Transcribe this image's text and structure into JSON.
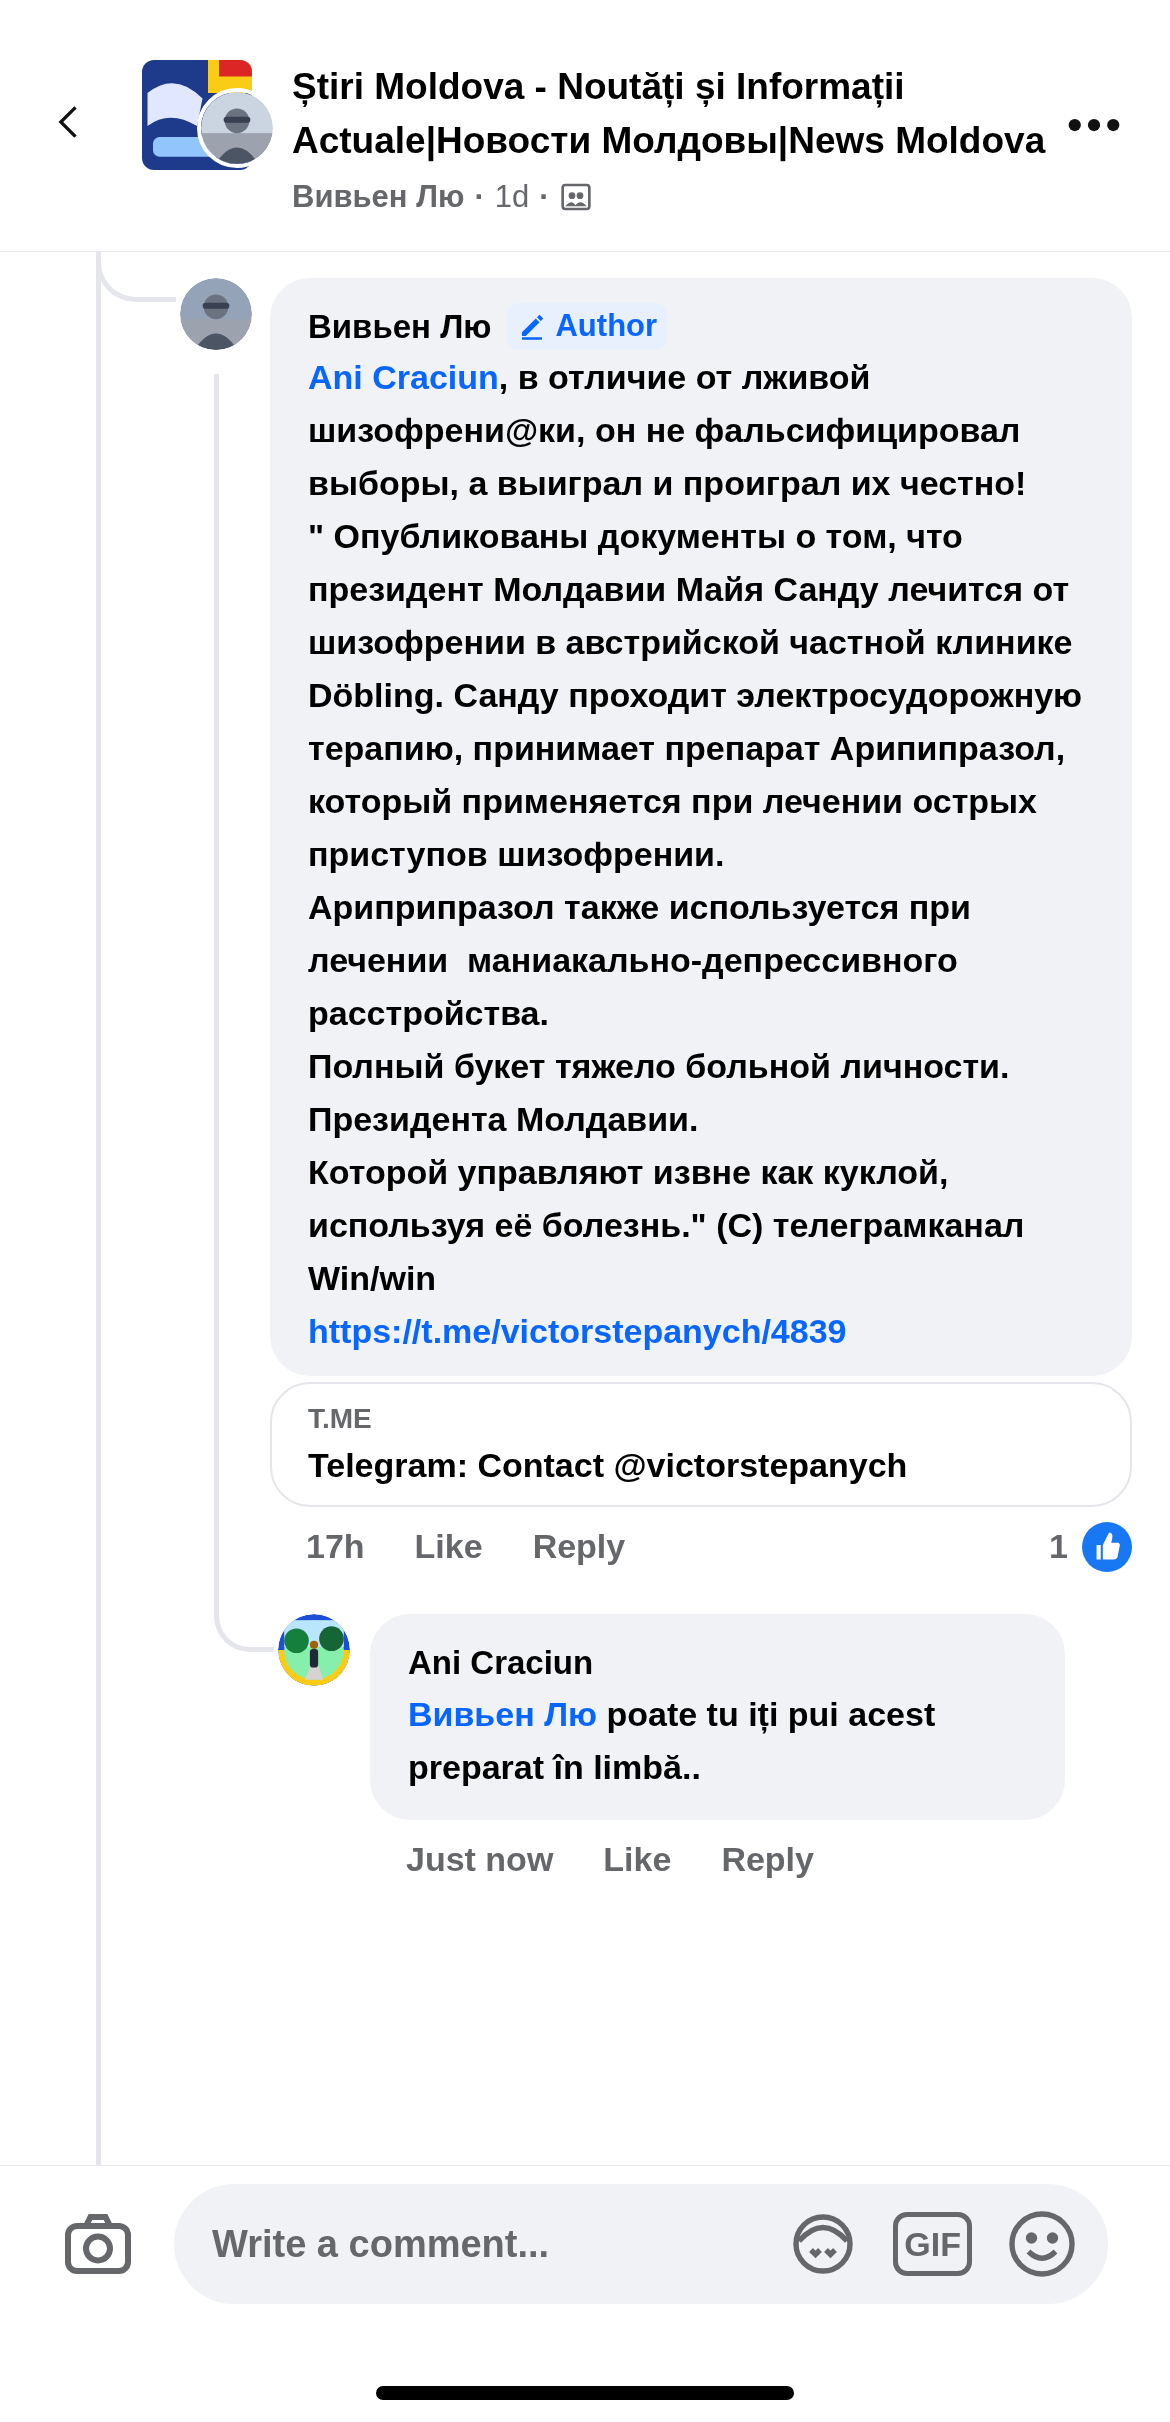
{
  "header": {
    "title": "Știri Moldova - Noutăți și Informații Actuale|Новости Молдовы|News Moldova",
    "author": "Вивьен Лю",
    "sep1": "·",
    "time": "1d",
    "sep2": "·"
  },
  "comment": {
    "author": "Вивьен Лю",
    "badge": "Author",
    "paragraphs": [
      {
        "mention": "Ani Craciun",
        "text": ", в отличие от лживой шизофрени@ки, он не фальсифицировал выборы, а выиграл и проиграл их честно!"
      },
      {
        "text": "\" Опубликованы документы о том, что президент Молдавии Майя Санду лечится от шизофрении в австрийской частной клинике Döbling. Санду проходит электросудорожную терапию, принимает препарат Арипипразол, который применяется при лечении острых приступов шизофрении."
      },
      {
        "text": "Ариприпразол также используется при лечении  маниакально-депрессивного расстройства."
      },
      {
        "text": "Полный букет тяжело больной личности."
      },
      {
        "text": "Президента Молдавии."
      },
      {
        "text": "Которой управляют извне как куклой, используя её болезнь.\" (С) телеграмканал Win/win"
      }
    ],
    "link": "https://t.me/victorstepanych/4839",
    "preview": {
      "domain": "T.ME",
      "title": "Telegram: Contact @victorstepanych"
    },
    "time": "17h",
    "actions": [
      "Like",
      "Reply"
    ],
    "reaction_count": "1"
  },
  "reply": {
    "author": "Ani Craciun",
    "mention": "Вивьен Лю",
    "text": " poate tu iți pui acest preparat în limbă..",
    "time": "Just now",
    "actions": [
      "Like",
      "Reply"
    ]
  },
  "composer": {
    "placeholder": "Write a comment...",
    "gif": "GIF"
  }
}
